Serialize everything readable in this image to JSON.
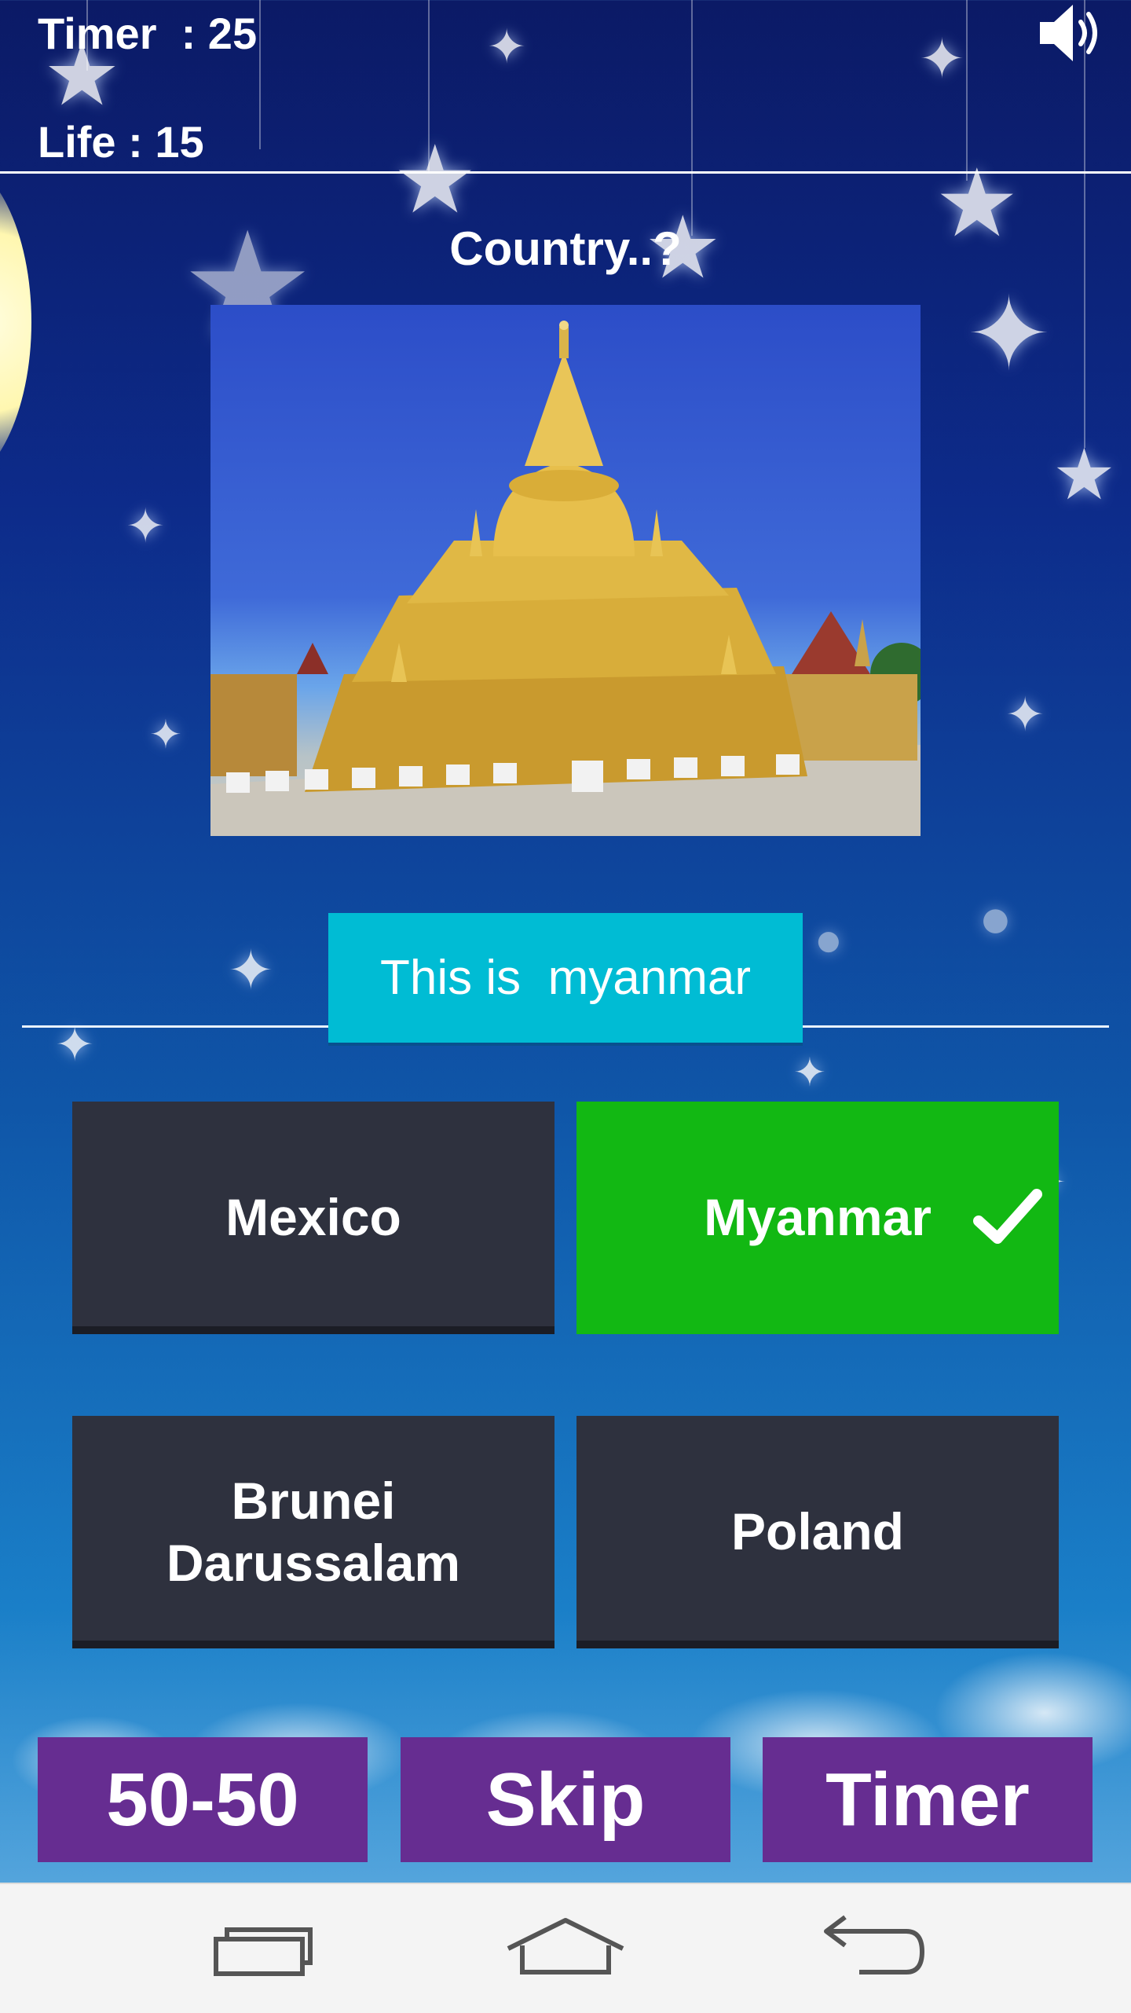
{
  "hud": {
    "timer_text": "Timer  : 25",
    "life_text": "Life : 15",
    "sound_icon": "speaker-volume-icon"
  },
  "question": {
    "title": "Country..?",
    "image_subject": "golden-pagoda-photo"
  },
  "feedback": {
    "text": "This is  myanmar"
  },
  "answers": [
    {
      "label": "Mexico",
      "state": "default"
    },
    {
      "label": "Myanmar",
      "state": "correct"
    },
    {
      "label": "Brunei\nDarussalam",
      "state": "default"
    },
    {
      "label": "Poland",
      "state": "default"
    }
  ],
  "lifelines": [
    {
      "label": "50-50"
    },
    {
      "label": "Skip"
    },
    {
      "label": "Timer"
    }
  ],
  "navbar": {
    "icons": [
      "recent-apps-icon",
      "home-icon",
      "back-icon"
    ]
  },
  "colors": {
    "answer_default": "#2e313e",
    "answer_correct": "#12b813",
    "feedback_bg": "#00bcd4",
    "lifeline_bg": "#662d91"
  }
}
